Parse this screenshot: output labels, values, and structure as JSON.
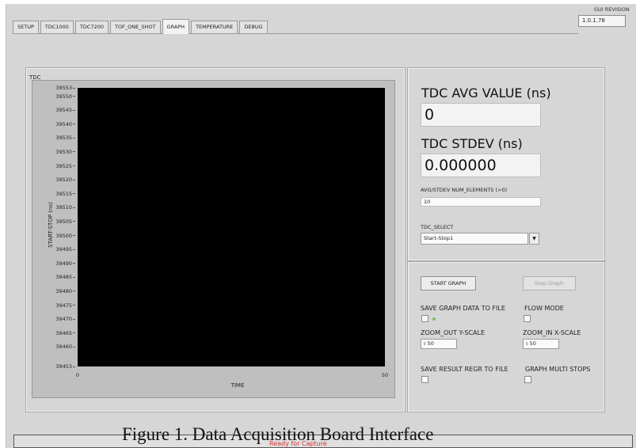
{
  "tabs": [
    "SETUP",
    "TDC1000",
    "TDC7200",
    "TOF_ONE_SHOT",
    "GRAPH",
    "TEMPERATURE",
    "DEBUG"
  ],
  "active_tab": "GRAPH",
  "gui_revision": {
    "label": "GUI REVISION",
    "value": "1.0.1.76"
  },
  "graph": {
    "title": "TDC",
    "ylabel": "START-STOP (ns)",
    "xlabel": "TIME",
    "plot_background": "#000000"
  },
  "chart_data": {
    "type": "line",
    "title": "TDC",
    "xlabel": "TIME",
    "ylabel": "START-STOP (ns)",
    "xlim": [
      0,
      50
    ],
    "ylim": [
      39453,
      39553
    ],
    "x_ticks": [
      "0",
      "50"
    ],
    "y_ticks": [
      "39553",
      "39550",
      "39545",
      "39540",
      "39535",
      "39530",
      "39525",
      "39520",
      "39515",
      "39510",
      "39505",
      "39500",
      "39495",
      "39490",
      "39485",
      "39480",
      "39475",
      "39470",
      "39465",
      "39460",
      "39453"
    ],
    "series": []
  },
  "avg": {
    "avg_label": "TDC AVG VALUE (ns)",
    "avg_value": "0",
    "stdev_label": "TDC STDEV (ns)",
    "stdev_value": "0.000000",
    "num_elements_label": "AVG/STDEV NUM_ELEMENTS (>0)",
    "num_elements_value": "10",
    "tdc_select_label": "TDC_SELECT",
    "tdc_select_value": "Start-Stop1"
  },
  "controls": {
    "start_graph": "START GRAPH",
    "stop_graph": "Stop Graph",
    "save_graph_data": "SAVE GRAPH DATA TO FILE",
    "flow_mode": "FLOW MODE",
    "zoom_out_y": "ZOOM_OUT Y-SCALE",
    "zoom_out_y_value": "50",
    "zoom_in_x": "ZOOM_IN X-SCALE",
    "zoom_in_x_value": "50",
    "save_result_regr": "SAVE RESULT REGR TO FILE",
    "graph_multi_stops": "GRAPH MULTI STOPS"
  },
  "status": {
    "text": "Ready for Capture"
  },
  "caption": "Figure 1. Data Acquisition Board Interface",
  "colors": {
    "window_bg": "#d6d6d6",
    "status_text": "#d83232",
    "led_green": "#7fbf5a"
  }
}
